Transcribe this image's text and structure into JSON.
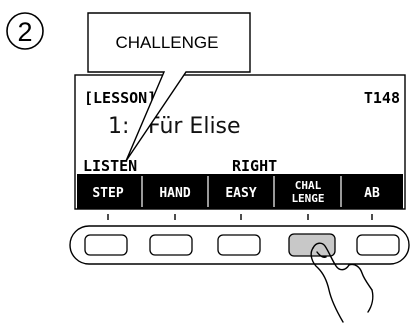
{
  "step_number": "2",
  "callout": {
    "text": "CHALLENGE"
  },
  "display": {
    "mode_label": "[LESSON]",
    "tempo": "T148",
    "song_number": "1:",
    "song_title": "Für Elise",
    "status_left": "LISTEN",
    "status_right": "RIGHT"
  },
  "softkeys": [
    {
      "lines": [
        "STEP"
      ]
    },
    {
      "lines": [
        "HAND"
      ]
    },
    {
      "lines": [
        "EASY"
      ]
    },
    {
      "lines": [
        "CHAL",
        "LENGE"
      ]
    },
    {
      "lines": [
        "AB"
      ]
    }
  ],
  "pressed_button_index": 3
}
